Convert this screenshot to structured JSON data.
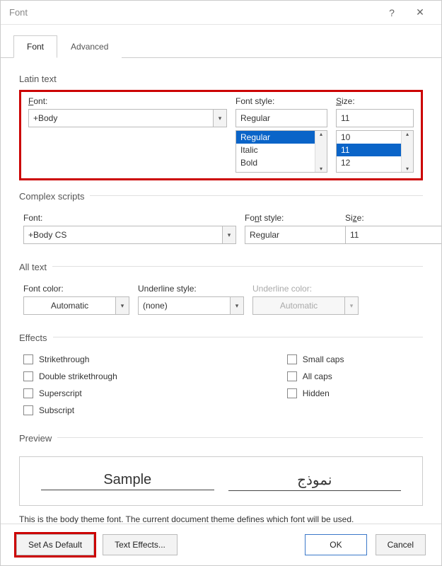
{
  "window": {
    "title": "Font"
  },
  "tabs": {
    "font": "Font",
    "advanced": "Advanced"
  },
  "latin": {
    "section": "Latin text",
    "font_label_pre": "F",
    "font_label_post": "ont:",
    "font_value": "+Body",
    "style_label": "Font style:",
    "style_value": "Regular",
    "style_options": [
      "Regular",
      "Italic",
      "Bold"
    ],
    "style_selected": "Regular",
    "size_label_pre": "S",
    "size_label_post": "ize:",
    "size_value": "11",
    "size_options": [
      "10",
      "11",
      "12"
    ],
    "size_selected": "11"
  },
  "complex": {
    "section": "Complex scripts",
    "font_label_pre": "F",
    "font_label_post": "ont:",
    "font_value": "+Body CS",
    "style_label_pre": "Fo",
    "style_label_u": "n",
    "style_label_post": "t style:",
    "style_value": "Regular",
    "size_label_pre": "Si",
    "size_label_u": "z",
    "size_label_post": "e:",
    "size_value": "11"
  },
  "alltext": {
    "section": "All text",
    "font_color_label": "Font color:",
    "font_color_value": "Automatic",
    "underline_style_label": "Underline style:",
    "underline_style_value": "(none)",
    "underline_color_label": "Underline color:",
    "underline_color_value": "Automatic"
  },
  "effects": {
    "section": "Effects",
    "strike": "Strikethrough",
    "dstrike": "Double strikethrough",
    "super": "Superscript",
    "sub": "Subscript",
    "smallcaps": "Small caps",
    "allcaps": "All caps",
    "hidden": "Hidden",
    "strike_u": "k",
    "dstrike_u": "l",
    "super_u": "p",
    "sub_u": "b",
    "smallcaps_u": "m",
    "allcaps_u": "A",
    "hidden_u": "H"
  },
  "preview": {
    "section": "Preview",
    "sample_left": "Sample",
    "sample_right": "نموذج",
    "desc": "This is the body theme font. The current document theme defines which font will be used."
  },
  "footer": {
    "set_default": "Set As Default",
    "set_default_u": "D",
    "text_effects": "Text Effects...",
    "text_effects_u": "E",
    "ok": "OK",
    "cancel": "Cancel"
  }
}
